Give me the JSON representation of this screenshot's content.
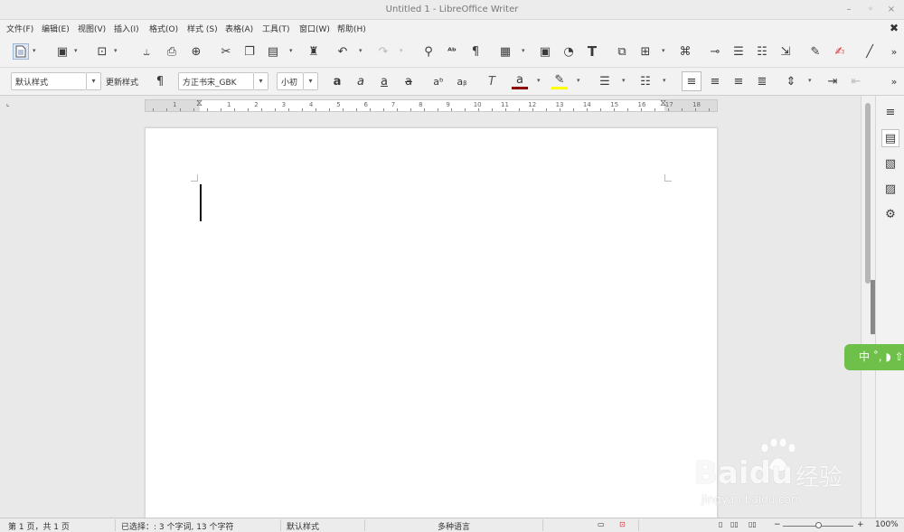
{
  "window": {
    "title": "Untitled 1 - LibreOffice Writer",
    "minimize_glyph": "–",
    "restore_glyph": "◦",
    "close_glyph": "×"
  },
  "menu": {
    "items": [
      "文件(F)",
      "编辑(E)",
      "视图(V)",
      "插入(I)",
      "格式(O)",
      "样式 (S)",
      "表格(A)",
      "工具(T)",
      "窗口(W)",
      "帮助(H)"
    ],
    "close_document_glyph": "✖"
  },
  "formatting": {
    "paragraph_style": "默认样式",
    "update_style_label": "更新样式",
    "font_name": "方正书宋_GBK",
    "font_size": "小初",
    "overflow_glyph": "»"
  },
  "ruler": {
    "numbers": [
      "1",
      "1",
      "2",
      "3",
      "4",
      "5",
      "6",
      "7",
      "8",
      "9",
      "10",
      "11",
      "12",
      "13",
      "14",
      "15",
      "16",
      "17",
      "18"
    ]
  },
  "ime": {
    "label": "中 ˚, ◗ ⇧"
  },
  "watermark": {
    "brand_text": "Baidu",
    "brand_cn": "经验",
    "url": "jingyan.baidu.com"
  },
  "status": {
    "page": "第 1 页，共 1 页",
    "selection": "已选择：: 3 个字词, 13 个字符",
    "style": "默认样式",
    "language": "多种语言",
    "zoom": "100%"
  },
  "colors": {
    "font_color_bar": "#8b0000",
    "highlight_bar": "#ffff00",
    "ime_green": "#6ec04a"
  }
}
